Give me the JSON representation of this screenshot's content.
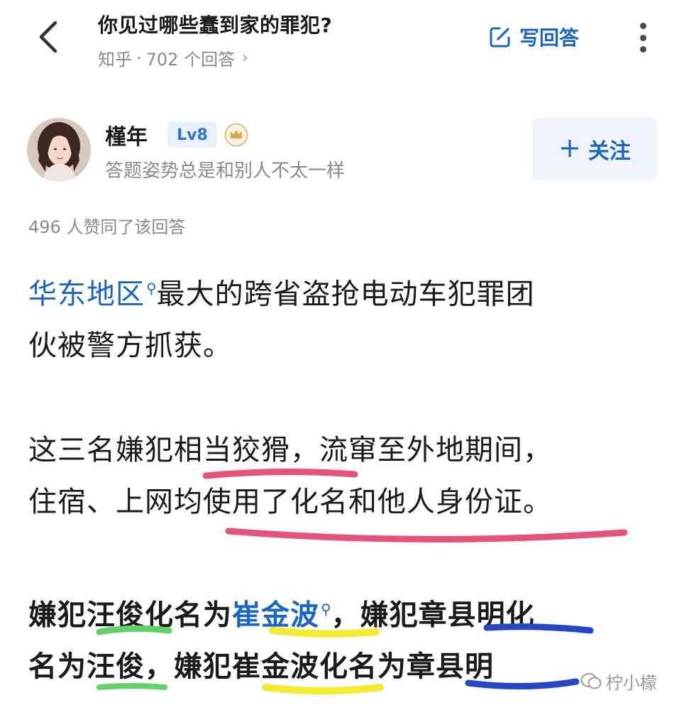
{
  "header": {
    "title": "你见过哪些蠢到家的罪犯?",
    "source": "知乎",
    "separator": "·",
    "answer_count": "702 个回答",
    "meta_chevron": "›",
    "write_answer_label": "写回答"
  },
  "author": {
    "name": "槿年",
    "level": "Lv8",
    "bio": "答题姿势总是和别人不太一样",
    "follow_label": "关注",
    "follow_plus": "+"
  },
  "answer": {
    "votes": "496 人赞同了该回答",
    "p1_link": "华东地区",
    "p1_line1_rest": "最大的跨省盗抢电动车犯罪团",
    "p1_line2": "伙被警方抓获。",
    "p2_line1": "这三名嫌犯相当狡猾，流窜至外地期间，",
    "p2_line2": "住宿、上网均使用了化名和他人身份证。",
    "p3_line1_a": "嫌犯汪俊化名为",
    "p3_line1_link": "崔金波",
    "p3_line1_b": "，嫌犯章县明化",
    "p3_line2": "名为汪俊，嫌犯崔金波化名为章县明"
  },
  "watermark": {
    "text": "柠小檬"
  },
  "colors": {
    "link": "#1866c9",
    "underline_pink": "#e8527a",
    "underline_green": "#5fd36a",
    "underline_yellow": "#f2ea2a",
    "underline_blue": "#2446c8"
  }
}
